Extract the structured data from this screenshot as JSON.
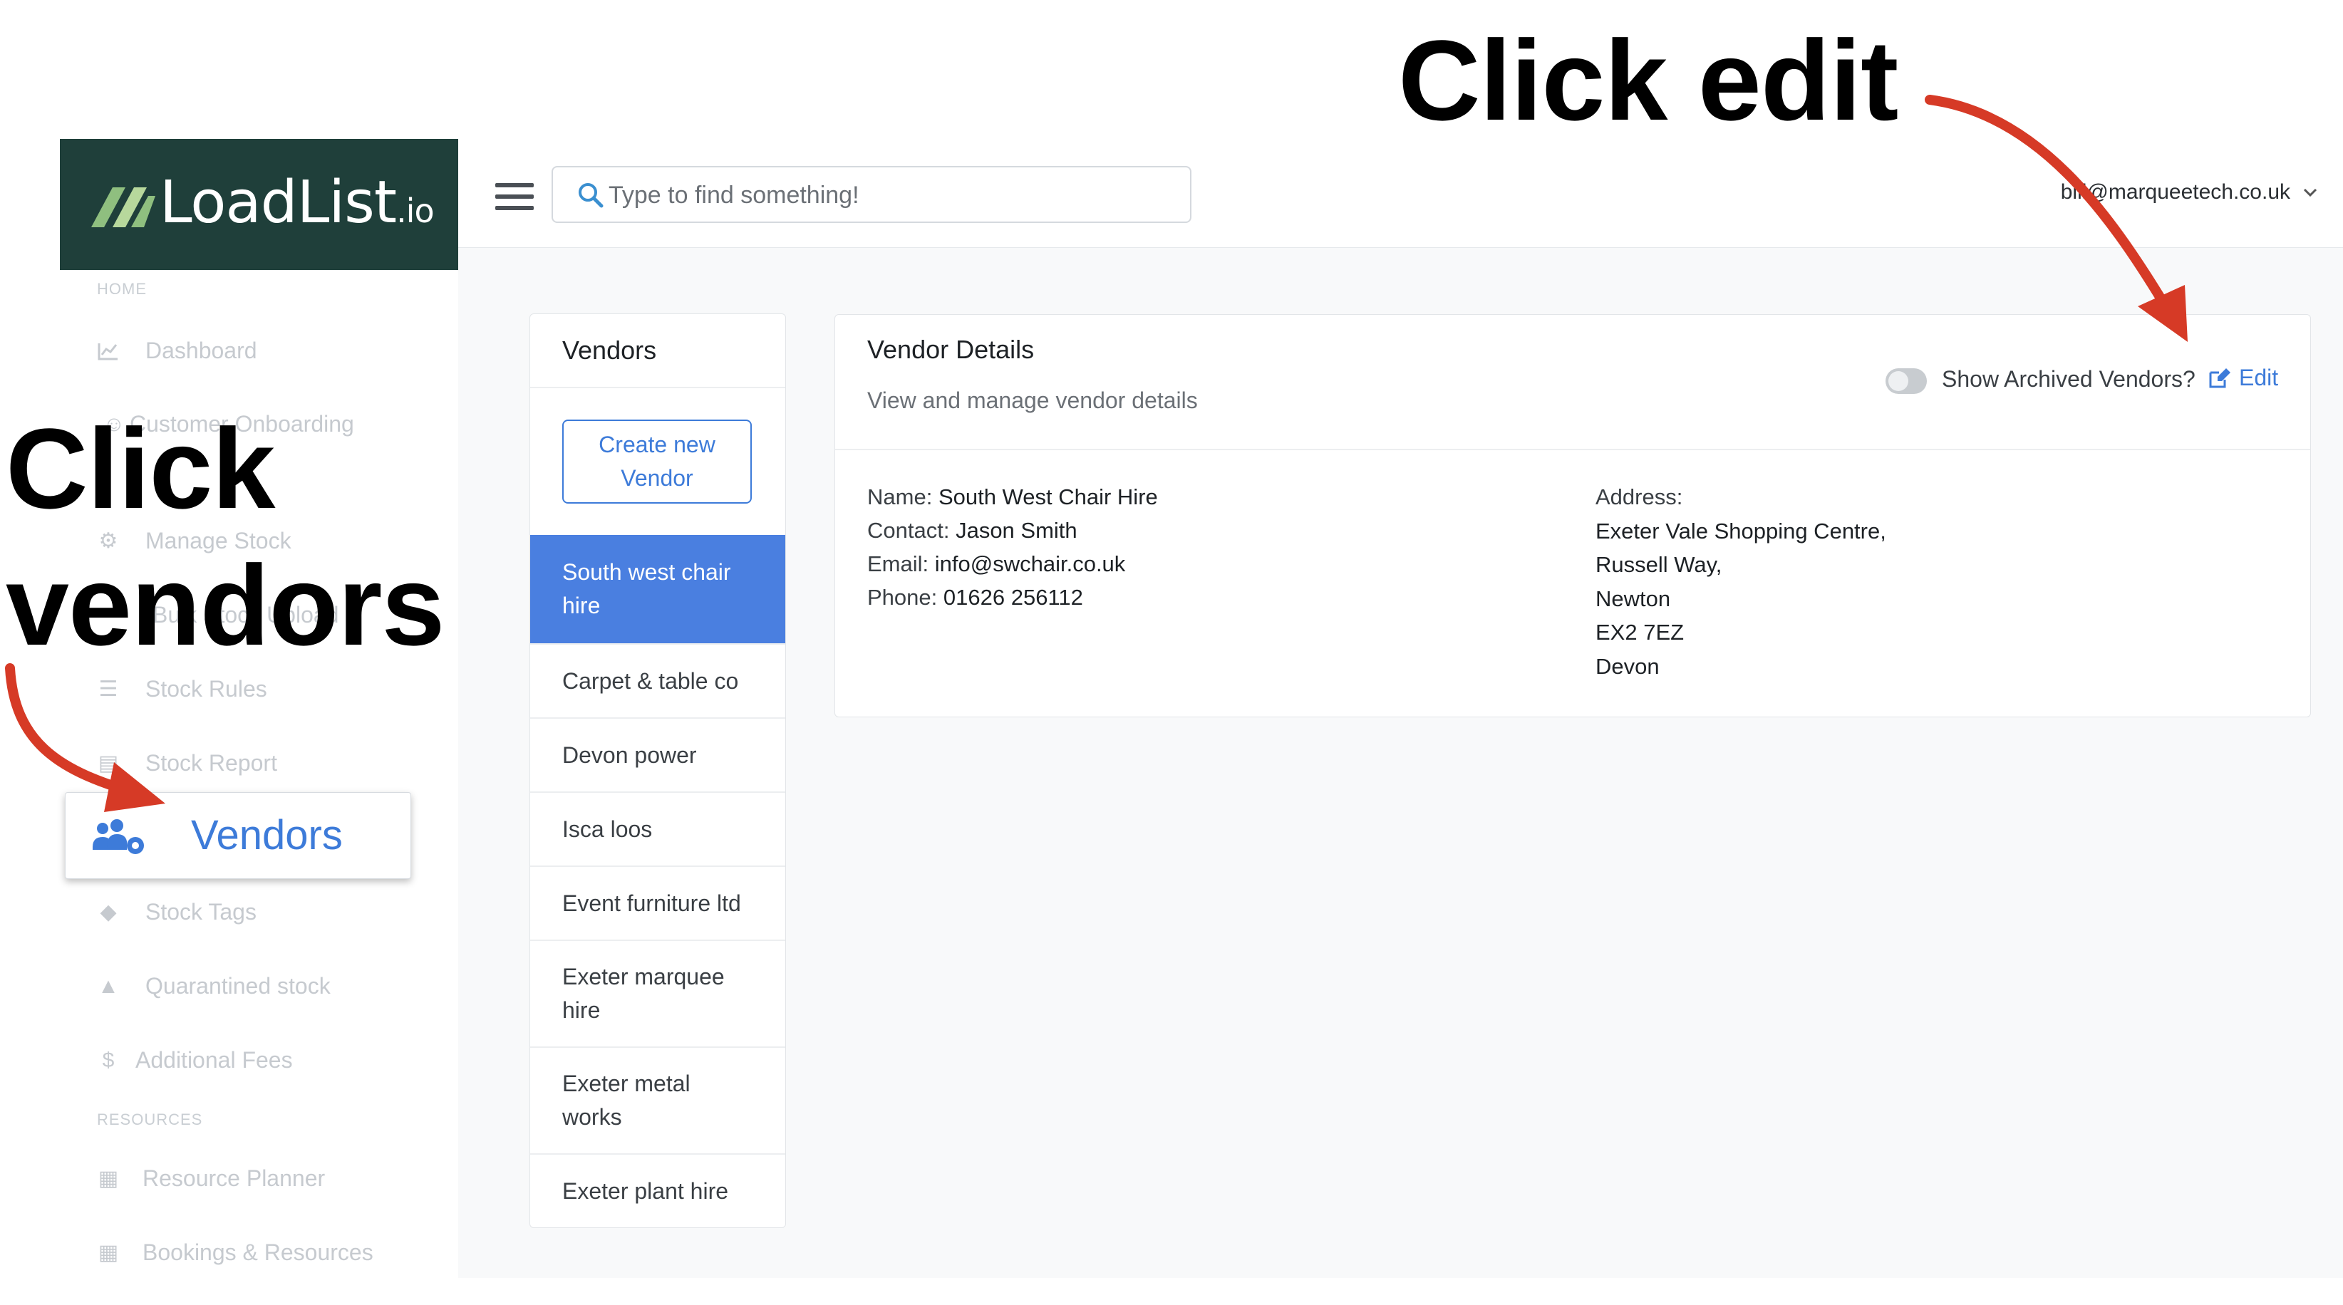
{
  "brand": {
    "name": "LoadList",
    "suffix": ".io"
  },
  "search": {
    "placeholder": "Type to find something!"
  },
  "user": {
    "email": "bill@marqueetech.co.uk"
  },
  "sidebar": {
    "sections": {
      "home": "HOME",
      "resources": "RESOURCES"
    },
    "items": [
      {
        "label": "Dashboard",
        "icon": "chart-line-icon"
      },
      {
        "label": "Customer Onboarding",
        "icon": "user-check-icon"
      },
      {
        "label": "Manage Stock",
        "icon": "gear-icon"
      },
      {
        "label": "Bulk Stock Upload",
        "icon": "upload-icon"
      },
      {
        "label": "Stock Rules",
        "icon": "list-icon"
      },
      {
        "label": "Stock Report",
        "icon": "report-icon"
      },
      {
        "label": "Vendors",
        "icon": "users-gear-icon"
      },
      {
        "label": "Stock Tags",
        "icon": "tags-icon"
      },
      {
        "label": "Quarantined stock",
        "icon": "warning-icon"
      },
      {
        "label": "Additional Fees",
        "icon": "dollar-icon"
      },
      {
        "label": "Resource Planner",
        "icon": "calendar-icon"
      },
      {
        "label": "Bookings & Resources",
        "icon": "calendar-icon"
      }
    ]
  },
  "vendors_panel": {
    "title": "Vendors",
    "create_label": "Create new Vendor",
    "vendors": [
      "South west chair hire",
      "Carpet & table co",
      "Devon power",
      "Isca loos",
      "Event furniture ltd",
      "Exeter marquee hire",
      "Exeter metal works",
      "Exeter plant hire"
    ],
    "selected_index": 0
  },
  "details": {
    "title": "Vendor Details",
    "subtitle": "View and manage vendor details",
    "archived_label": "Show Archived Vendors?",
    "archived_on": false,
    "edit_label": "Edit",
    "name_label": "Name:",
    "name": "South West Chair Hire",
    "contact_label": "Contact:",
    "contact": "Jason Smith",
    "email_label": "Email:",
    "email": "info@swchair.co.uk",
    "phone_label": "Phone:",
    "phone": "01626 256112",
    "address_label": "Address:",
    "address_lines": [
      "Exeter Vale Shopping Centre,",
      "Russell Way,",
      "Newton",
      "EX2 7EZ",
      "Devon"
    ]
  },
  "annotations": {
    "edit": "Click edit",
    "vendors_line1": "Click",
    "vendors_line2": "vendors"
  },
  "colors": {
    "accent": "#3d7bd9",
    "logo_bg": "#1f3f3a",
    "arrow": "#d63a26",
    "selected": "#4a7fe0"
  }
}
